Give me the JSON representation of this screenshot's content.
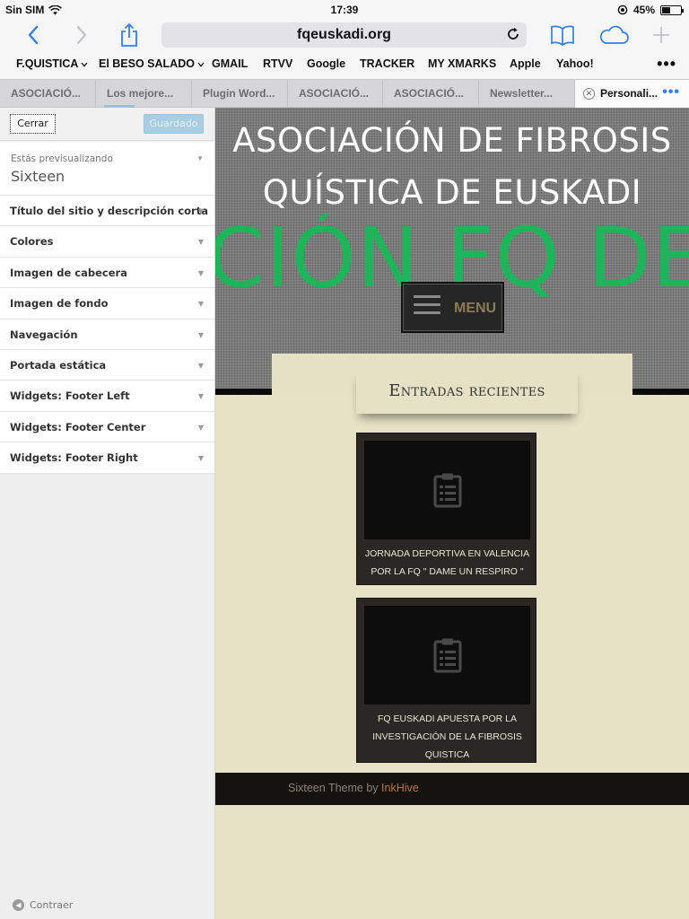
{
  "status_bar": {
    "carrier": "Sin SIM",
    "time": "17:39",
    "battery": "45%",
    "battery_level": 0.45
  },
  "browser": {
    "url": "fqeuskadi.org",
    "icons": {
      "back": "chevron-left-icon",
      "forward": "chevron-right-icon",
      "share": "share-icon",
      "reload": "reload-icon",
      "bookmarks": "book-icon",
      "cloud_tabs": "cloud-icon",
      "new_tab": "plus-icon"
    },
    "bookmarks": [
      {
        "label": "F.QUISTICA",
        "folder": true
      },
      {
        "label": "El BESO SALADO",
        "folder": true
      },
      {
        "label": "GMAIL"
      },
      {
        "label": "RTVV"
      },
      {
        "label": "Google"
      },
      {
        "label": "TRACKER"
      },
      {
        "label": "MY XMARKS"
      },
      {
        "label": "Apple"
      },
      {
        "label": "Yahoo!"
      }
    ],
    "more_label": "•••",
    "tabs": [
      {
        "label": "ASOCIACIÓ..."
      },
      {
        "label": "Los mejore..."
      },
      {
        "label": "Plugin Word..."
      },
      {
        "label": "ASOCIACIÓ..."
      },
      {
        "label": "ASOCIACIÓ..."
      },
      {
        "label": "Newsletter..."
      },
      {
        "label": "Personali...",
        "active": true
      }
    ],
    "tab_more": "•••"
  },
  "customizer": {
    "close_label": "Cerrar",
    "save_label": "Guardado",
    "preview_label": "Estás previsualizando",
    "theme_name": "Sixteen",
    "sections": [
      "Título del sitio y descripción corta",
      "Colores",
      "Imagen de cabecera",
      "Imagen de fondo",
      "Navegación",
      "Portada estática",
      "Widgets: Footer Left",
      "Widgets: Footer Center",
      "Widgets: Footer Right"
    ],
    "collapse_label": "Contraer"
  },
  "site": {
    "title_line1": "ASOCIACIÓN DE FIBROSIS",
    "title_line2": "QUÍSTICA DE EUSKADI",
    "marquee": "CIÓN FQ DE",
    "menu_label": "MENU",
    "widget_title": "Entradas recientes",
    "posts": [
      {
        "title": "JORNADA DEPORTIVA EN VALENCIA POR LA FQ \" DAME UN RESPIRO \""
      },
      {
        "title": "FQ EUSKADI APUESTA POR LA INVESTIGACIÓN DE LA FIBROSIS QUISTICA"
      }
    ],
    "footer_text": "Sixteen Theme by",
    "footer_link": "InkHive"
  },
  "colors": {
    "ios_blue": "#2f80f0",
    "marquee_green": "#1db45a",
    "page_background": "#e7e2c6",
    "save_button": "#a9cde2",
    "footer_link": "#b8743a"
  }
}
